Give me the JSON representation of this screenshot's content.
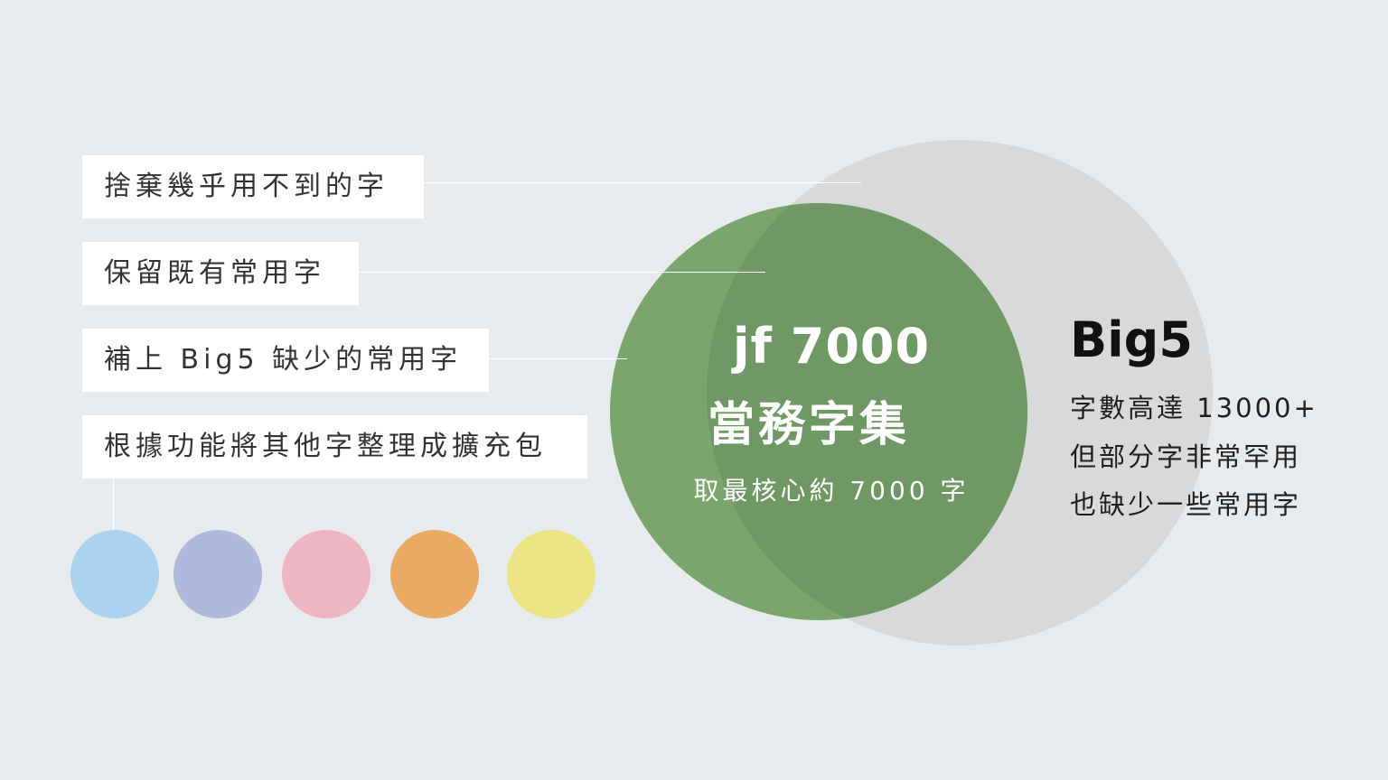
{
  "diagram": {
    "labels": [
      "捨棄幾乎用不到的字",
      "保留既有常用字",
      "補上 Big5 缺少的常用字",
      "根據功能將其他字整理成擴充包"
    ],
    "jf_set": {
      "title": "jf 7000",
      "subtitle": "當務字集",
      "description": "取最核心約 7000 字",
      "color": "#7aa56c",
      "overlap_color": "#709865"
    },
    "big5": {
      "title": "Big5",
      "lines": [
        "字數高達 13000+",
        "但部分字非常罕用",
        "也缺少一些常用字"
      ],
      "color": "#d8d9db"
    },
    "expansion_pack_colors": [
      "#abd3ed",
      "#b0b8dc",
      "#eeb5c4",
      "#eaaa62",
      "#ebe586"
    ]
  }
}
